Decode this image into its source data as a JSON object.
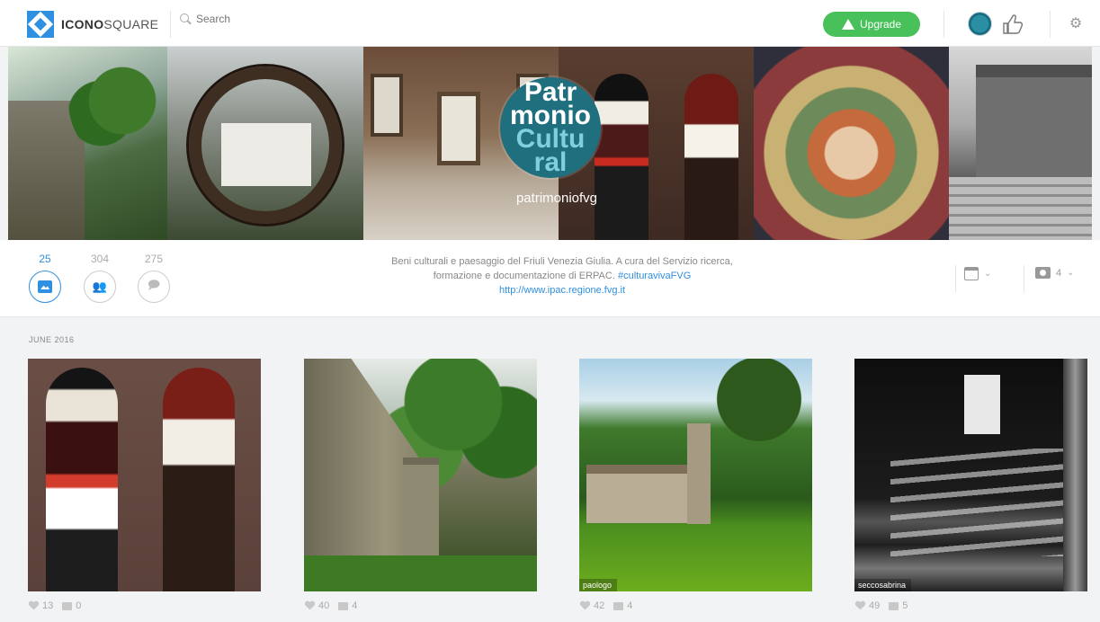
{
  "header": {
    "logo_bold": "ICONO",
    "logo_light": "SQUARE",
    "search_placeholder": "Search",
    "upgrade_label": "Upgrade"
  },
  "profile": {
    "brand_lines": [
      "Patr",
      "monio",
      "Cultu",
      "ral"
    ],
    "handle": "patrimoniofvg",
    "stats": [
      {
        "value": "25",
        "icon": "photo-icon",
        "active": true
      },
      {
        "value": "304",
        "icon": "people-icon",
        "active": false
      },
      {
        "value": "275",
        "icon": "followers-icon",
        "active": false
      }
    ],
    "bio_line1": "Beni culturali e paesaggio del Friuli Venezia Giulia. A cura del Servizio ricerca,",
    "bio_line2_text": "formazione e documentazione di ERPAC.",
    "bio_hashtag": "#culturavivaFVG",
    "bio_link": "http://www.ipac.regione.fvg.it",
    "photo_count": "4"
  },
  "feed": {
    "section_title": "JUNE 2016",
    "posts": [
      {
        "likes": "13",
        "comments": "0",
        "caption": ""
      },
      {
        "likes": "40",
        "comments": "4",
        "caption": ""
      },
      {
        "likes": "42",
        "comments": "4",
        "caption": "paologo"
      },
      {
        "likes": "49",
        "comments": "5",
        "caption": "seccosabrina"
      }
    ]
  },
  "colors": {
    "accent": "#2f8fe0",
    "upgrade": "#49c15a"
  }
}
